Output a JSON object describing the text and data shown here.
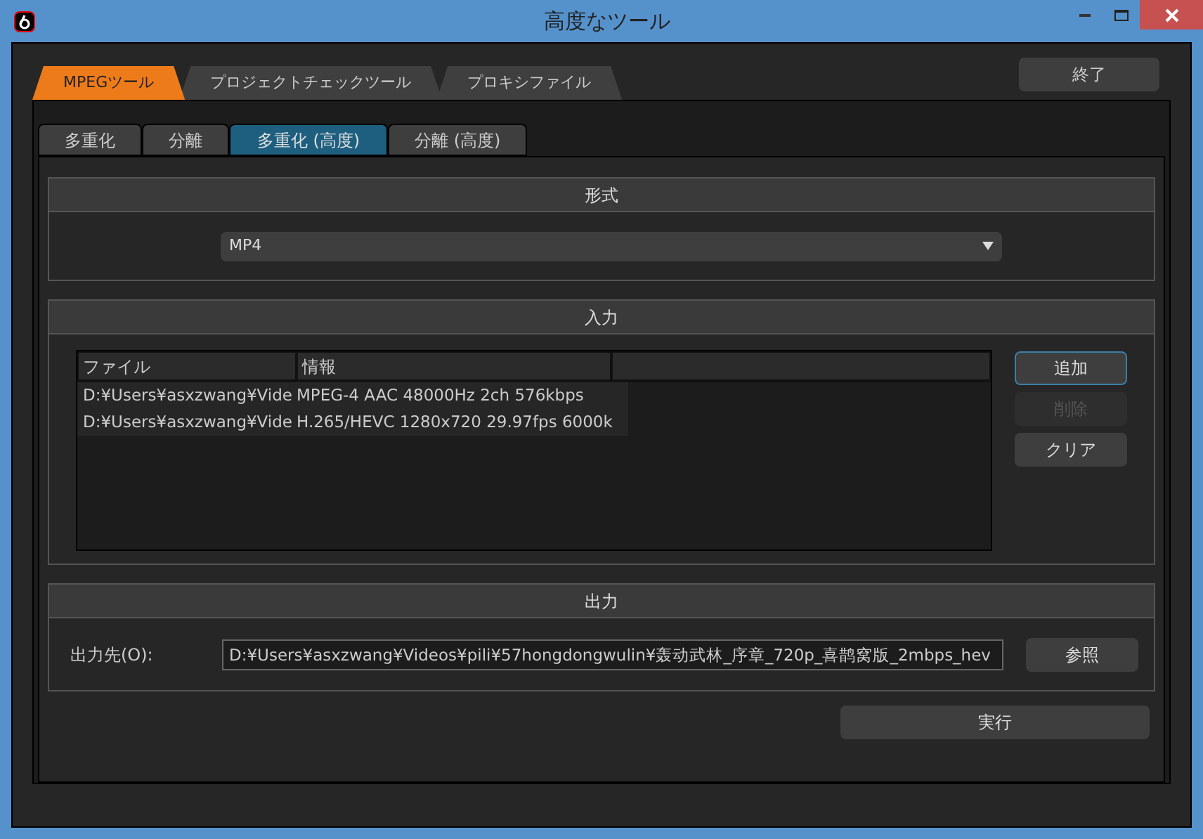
{
  "window": {
    "title": "高度なツール"
  },
  "main_tabs": [
    {
      "label": "MPEGツール",
      "selected": true
    },
    {
      "label": "プロジェクトチェックツール",
      "selected": false
    },
    {
      "label": "プロキシファイル",
      "selected": false
    }
  ],
  "close_button": "終了",
  "sub_tabs": [
    {
      "label": "多重化",
      "selected": false
    },
    {
      "label": "分離",
      "selected": false
    },
    {
      "label": "多重化 (高度)",
      "selected": true
    },
    {
      "label": "分離 (高度)",
      "selected": false
    }
  ],
  "format": {
    "title": "形式",
    "value": "MP4"
  },
  "input": {
    "title": "入力",
    "columns": [
      "ファイル",
      "情報"
    ],
    "rows": [
      [
        "D:¥Users¥asxzwang¥Vide",
        "MPEG-4 AAC 48000Hz 2ch 576kbps"
      ],
      [
        "D:¥Users¥asxzwang¥Vide",
        "H.265/HEVC 1280x720 29.97fps 6000k"
      ]
    ],
    "buttons": [
      {
        "label": "追加",
        "disabled": false,
        "focused": true
      },
      {
        "label": "削除",
        "disabled": true,
        "focused": false
      },
      {
        "label": "クリア",
        "disabled": false,
        "focused": false
      }
    ]
  },
  "output": {
    "title": "出力",
    "label": "出力先(O):",
    "value": "D:¥Users¥asxzwang¥Videos¥pili¥57hongdongwulin¥轰动武林_序章_720p_喜鹊窝版_2mbps_hev",
    "browse_button": "参照"
  },
  "run_button": "実行"
}
